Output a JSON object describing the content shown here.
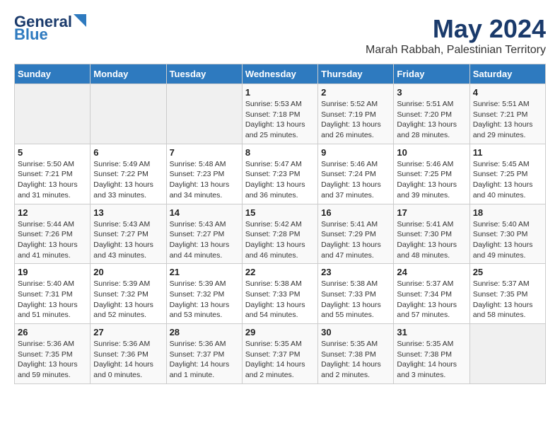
{
  "logo": {
    "line1": "General",
    "line2": "Blue"
  },
  "title": "May 2024",
  "subtitle": "Marah Rabbah, Palestinian Territory",
  "days_of_week": [
    "Sunday",
    "Monday",
    "Tuesday",
    "Wednesday",
    "Thursday",
    "Friday",
    "Saturday"
  ],
  "weeks": [
    [
      {
        "day": "",
        "info": ""
      },
      {
        "day": "",
        "info": ""
      },
      {
        "day": "",
        "info": ""
      },
      {
        "day": "1",
        "info": "Sunrise: 5:53 AM\nSunset: 7:18 PM\nDaylight: 13 hours\nand 25 minutes."
      },
      {
        "day": "2",
        "info": "Sunrise: 5:52 AM\nSunset: 7:19 PM\nDaylight: 13 hours\nand 26 minutes."
      },
      {
        "day": "3",
        "info": "Sunrise: 5:51 AM\nSunset: 7:20 PM\nDaylight: 13 hours\nand 28 minutes."
      },
      {
        "day": "4",
        "info": "Sunrise: 5:51 AM\nSunset: 7:21 PM\nDaylight: 13 hours\nand 29 minutes."
      }
    ],
    [
      {
        "day": "5",
        "info": "Sunrise: 5:50 AM\nSunset: 7:21 PM\nDaylight: 13 hours\nand 31 minutes."
      },
      {
        "day": "6",
        "info": "Sunrise: 5:49 AM\nSunset: 7:22 PM\nDaylight: 13 hours\nand 33 minutes."
      },
      {
        "day": "7",
        "info": "Sunrise: 5:48 AM\nSunset: 7:23 PM\nDaylight: 13 hours\nand 34 minutes."
      },
      {
        "day": "8",
        "info": "Sunrise: 5:47 AM\nSunset: 7:23 PM\nDaylight: 13 hours\nand 36 minutes."
      },
      {
        "day": "9",
        "info": "Sunrise: 5:46 AM\nSunset: 7:24 PM\nDaylight: 13 hours\nand 37 minutes."
      },
      {
        "day": "10",
        "info": "Sunrise: 5:46 AM\nSunset: 7:25 PM\nDaylight: 13 hours\nand 39 minutes."
      },
      {
        "day": "11",
        "info": "Sunrise: 5:45 AM\nSunset: 7:25 PM\nDaylight: 13 hours\nand 40 minutes."
      }
    ],
    [
      {
        "day": "12",
        "info": "Sunrise: 5:44 AM\nSunset: 7:26 PM\nDaylight: 13 hours\nand 41 minutes."
      },
      {
        "day": "13",
        "info": "Sunrise: 5:43 AM\nSunset: 7:27 PM\nDaylight: 13 hours\nand 43 minutes."
      },
      {
        "day": "14",
        "info": "Sunrise: 5:43 AM\nSunset: 7:27 PM\nDaylight: 13 hours\nand 44 minutes."
      },
      {
        "day": "15",
        "info": "Sunrise: 5:42 AM\nSunset: 7:28 PM\nDaylight: 13 hours\nand 46 minutes."
      },
      {
        "day": "16",
        "info": "Sunrise: 5:41 AM\nSunset: 7:29 PM\nDaylight: 13 hours\nand 47 minutes."
      },
      {
        "day": "17",
        "info": "Sunrise: 5:41 AM\nSunset: 7:30 PM\nDaylight: 13 hours\nand 48 minutes."
      },
      {
        "day": "18",
        "info": "Sunrise: 5:40 AM\nSunset: 7:30 PM\nDaylight: 13 hours\nand 49 minutes."
      }
    ],
    [
      {
        "day": "19",
        "info": "Sunrise: 5:40 AM\nSunset: 7:31 PM\nDaylight: 13 hours\nand 51 minutes."
      },
      {
        "day": "20",
        "info": "Sunrise: 5:39 AM\nSunset: 7:32 PM\nDaylight: 13 hours\nand 52 minutes."
      },
      {
        "day": "21",
        "info": "Sunrise: 5:39 AM\nSunset: 7:32 PM\nDaylight: 13 hours\nand 53 minutes."
      },
      {
        "day": "22",
        "info": "Sunrise: 5:38 AM\nSunset: 7:33 PM\nDaylight: 13 hours\nand 54 minutes."
      },
      {
        "day": "23",
        "info": "Sunrise: 5:38 AM\nSunset: 7:33 PM\nDaylight: 13 hours\nand 55 minutes."
      },
      {
        "day": "24",
        "info": "Sunrise: 5:37 AM\nSunset: 7:34 PM\nDaylight: 13 hours\nand 57 minutes."
      },
      {
        "day": "25",
        "info": "Sunrise: 5:37 AM\nSunset: 7:35 PM\nDaylight: 13 hours\nand 58 minutes."
      }
    ],
    [
      {
        "day": "26",
        "info": "Sunrise: 5:36 AM\nSunset: 7:35 PM\nDaylight: 13 hours\nand 59 minutes."
      },
      {
        "day": "27",
        "info": "Sunrise: 5:36 AM\nSunset: 7:36 PM\nDaylight: 14 hours\nand 0 minutes."
      },
      {
        "day": "28",
        "info": "Sunrise: 5:36 AM\nSunset: 7:37 PM\nDaylight: 14 hours\nand 1 minute."
      },
      {
        "day": "29",
        "info": "Sunrise: 5:35 AM\nSunset: 7:37 PM\nDaylight: 14 hours\nand 2 minutes."
      },
      {
        "day": "30",
        "info": "Sunrise: 5:35 AM\nSunset: 7:38 PM\nDaylight: 14 hours\nand 2 minutes."
      },
      {
        "day": "31",
        "info": "Sunrise: 5:35 AM\nSunset: 7:38 PM\nDaylight: 14 hours\nand 3 minutes."
      },
      {
        "day": "",
        "info": ""
      }
    ]
  ]
}
